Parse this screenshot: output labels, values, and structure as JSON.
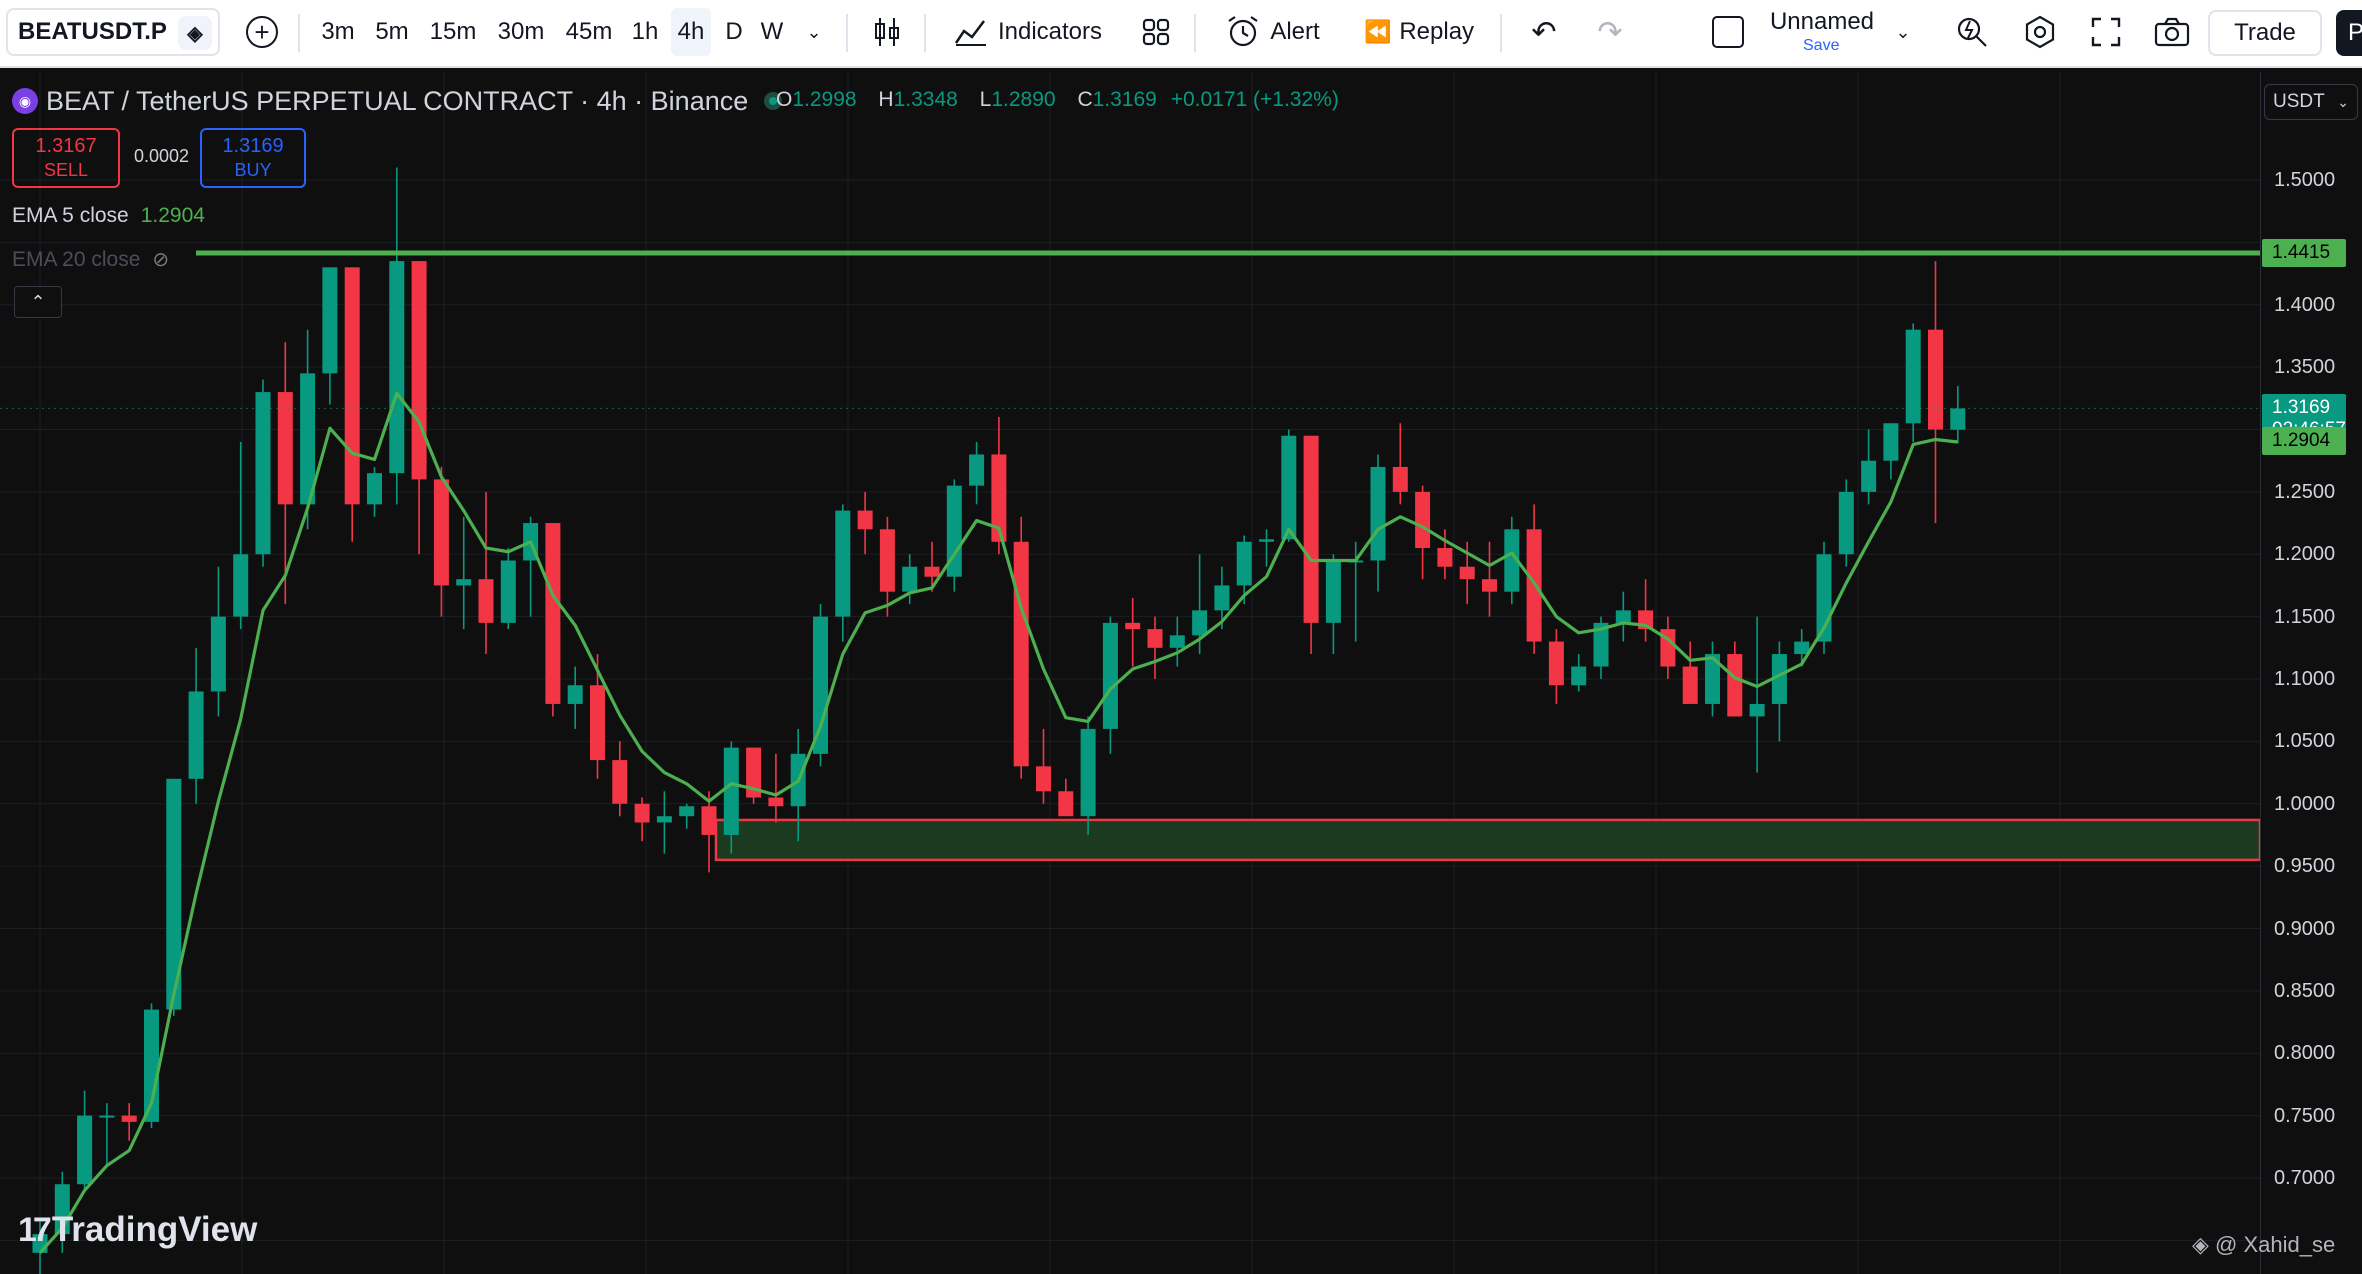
{
  "toolbar": {
    "symbol": "BEATUSDT.P",
    "timeframes": [
      "3m",
      "5m",
      "15m",
      "30m",
      "45m",
      "1h",
      "4h",
      "D",
      "W"
    ],
    "active_timeframe": "4h",
    "indicators_label": "Indicators",
    "alert_label": "Alert",
    "replay_label": "Replay",
    "layout_name": "Unnamed",
    "save_label": "Save",
    "trade_label": "Trade",
    "publish_initial": "P"
  },
  "legend": {
    "title": "BEAT / TetherUS PERPETUAL CONTRACT · 4h · Binance",
    "o_key": "O",
    "o": "1.2998",
    "h_key": "H",
    "h": "1.3348",
    "l_key": "L",
    "l": "1.2890",
    "c_key": "C",
    "c": "1.3169",
    "change": "+0.0171 (+1.32%)",
    "sell_price": "1.3167",
    "sell_label": "SELL",
    "spread": "0.0002",
    "buy_price": "1.3169",
    "buy_label": "BUY",
    "ema5_name": "EMA 5 close",
    "ema5_value": "1.2904",
    "ema20_name": "EMA 20 close"
  },
  "price_axis": {
    "currency": "USDT",
    "ticks": [
      "1.5000",
      "1.4000",
      "1.3500",
      "1.2500",
      "1.2000",
      "1.1500",
      "1.1000",
      "1.0500",
      "1.0000",
      "0.9500",
      "0.9000",
      "0.8500",
      "0.8000",
      "0.7500",
      "0.7000"
    ],
    "level_badge": "1.4415",
    "price_badge": "1.3169",
    "countdown": "02:46:57",
    "ema_badge": "1.2904"
  },
  "colors": {
    "up": "#089981",
    "down": "#f23645",
    "ema5": "#4caf50",
    "level_line": "#4caf50",
    "zone_fill": "#1b3a1f",
    "zone_border": "#f23645"
  },
  "chart_data": {
    "type": "candlestick",
    "symbol": "BEATUSDT.P",
    "interval": "4h",
    "ylim": [
      0.62,
      1.54
    ],
    "horizontal_level": 1.4415,
    "support_zone": [
      0.955,
      0.987
    ],
    "candles": [
      {
        "o": 0.64,
        "h": 0.665,
        "l": 0.62,
        "c": 0.655
      },
      {
        "o": 0.655,
        "h": 0.705,
        "l": 0.64,
        "c": 0.695
      },
      {
        "o": 0.695,
        "h": 0.77,
        "l": 0.69,
        "c": 0.75
      },
      {
        "o": 0.75,
        "h": 0.76,
        "l": 0.71,
        "c": 0.75
      },
      {
        "o": 0.75,
        "h": 0.76,
        "l": 0.73,
        "c": 0.745
      },
      {
        "o": 0.745,
        "h": 0.84,
        "l": 0.74,
        "c": 0.835
      },
      {
        "o": 0.835,
        "h": 0.98,
        "l": 0.83,
        "c": 1.02
      },
      {
        "o": 1.02,
        "h": 1.125,
        "l": 1.0,
        "c": 1.09
      },
      {
        "o": 1.09,
        "h": 1.19,
        "l": 1.07,
        "c": 1.15
      },
      {
        "o": 1.15,
        "h": 1.29,
        "l": 1.14,
        "c": 1.2
      },
      {
        "o": 1.2,
        "h": 1.34,
        "l": 1.19,
        "c": 1.33
      },
      {
        "o": 1.33,
        "h": 1.37,
        "l": 1.16,
        "c": 1.24
      },
      {
        "o": 1.24,
        "h": 1.38,
        "l": 1.22,
        "c": 1.345
      },
      {
        "o": 1.345,
        "h": 1.425,
        "l": 1.32,
        "c": 1.43
      },
      {
        "o": 1.43,
        "h": 1.41,
        "l": 1.21,
        "c": 1.24
      },
      {
        "o": 1.24,
        "h": 1.27,
        "l": 1.23,
        "c": 1.265
      },
      {
        "o": 1.265,
        "h": 1.51,
        "l": 1.24,
        "c": 1.435
      },
      {
        "o": 1.435,
        "h": 1.435,
        "l": 1.2,
        "c": 1.26
      },
      {
        "o": 1.26,
        "h": 1.27,
        "l": 1.15,
        "c": 1.175
      },
      {
        "o": 1.175,
        "h": 1.23,
        "l": 1.14,
        "c": 1.18
      },
      {
        "o": 1.18,
        "h": 1.25,
        "l": 1.12,
        "c": 1.145
      },
      {
        "o": 1.145,
        "h": 1.205,
        "l": 1.14,
        "c": 1.195
      },
      {
        "o": 1.195,
        "h": 1.23,
        "l": 1.15,
        "c": 1.225
      },
      {
        "o": 1.225,
        "h": 1.215,
        "l": 1.07,
        "c": 1.08
      },
      {
        "o": 1.08,
        "h": 1.11,
        "l": 1.06,
        "c": 1.095
      },
      {
        "o": 1.095,
        "h": 1.12,
        "l": 1.02,
        "c": 1.035
      },
      {
        "o": 1.035,
        "h": 1.05,
        "l": 0.99,
        "c": 1.0
      },
      {
        "o": 1.0,
        "h": 1.005,
        "l": 0.97,
        "c": 0.985
      },
      {
        "o": 0.985,
        "h": 1.01,
        "l": 0.96,
        "c": 0.99
      },
      {
        "o": 0.99,
        "h": 1.0,
        "l": 0.98,
        "c": 0.998
      },
      {
        "o": 0.998,
        "h": 1.01,
        "l": 0.945,
        "c": 0.975
      },
      {
        "o": 0.975,
        "h": 1.05,
        "l": 0.96,
        "c": 1.045
      },
      {
        "o": 1.045,
        "h": 1.045,
        "l": 1.0,
        "c": 1.005
      },
      {
        "o": 1.005,
        "h": 1.04,
        "l": 0.985,
        "c": 0.998
      },
      {
        "o": 0.998,
        "h": 1.06,
        "l": 0.97,
        "c": 1.04
      },
      {
        "o": 1.04,
        "h": 1.16,
        "l": 1.03,
        "c": 1.15
      },
      {
        "o": 1.15,
        "h": 1.24,
        "l": 1.13,
        "c": 1.235
      },
      {
        "o": 1.235,
        "h": 1.25,
        "l": 1.2,
        "c": 1.22
      },
      {
        "o": 1.22,
        "h": 1.23,
        "l": 1.15,
        "c": 1.17
      },
      {
        "o": 1.17,
        "h": 1.2,
        "l": 1.16,
        "c": 1.19
      },
      {
        "o": 1.19,
        "h": 1.21,
        "l": 1.17,
        "c": 1.182
      },
      {
        "o": 1.182,
        "h": 1.26,
        "l": 1.17,
        "c": 1.255
      },
      {
        "o": 1.255,
        "h": 1.29,
        "l": 1.24,
        "c": 1.28
      },
      {
        "o": 1.28,
        "h": 1.31,
        "l": 1.2,
        "c": 1.21
      },
      {
        "o": 1.21,
        "h": 1.23,
        "l": 1.02,
        "c": 1.03
      },
      {
        "o": 1.03,
        "h": 1.06,
        "l": 1.0,
        "c": 1.01
      },
      {
        "o": 1.01,
        "h": 1.02,
        "l": 0.99,
        "c": 0.99
      },
      {
        "o": 0.99,
        "h": 1.07,
        "l": 0.975,
        "c": 1.06
      },
      {
        "o": 1.06,
        "h": 1.15,
        "l": 1.04,
        "c": 1.145
      },
      {
        "o": 1.145,
        "h": 1.165,
        "l": 1.11,
        "c": 1.14
      },
      {
        "o": 1.14,
        "h": 1.15,
        "l": 1.1,
        "c": 1.125
      },
      {
        "o": 1.125,
        "h": 1.15,
        "l": 1.11,
        "c": 1.135
      },
      {
        "o": 1.135,
        "h": 1.2,
        "l": 1.12,
        "c": 1.155
      },
      {
        "o": 1.155,
        "h": 1.19,
        "l": 1.14,
        "c": 1.175
      },
      {
        "o": 1.175,
        "h": 1.215,
        "l": 1.16,
        "c": 1.21
      },
      {
        "o": 1.21,
        "h": 1.22,
        "l": 1.19,
        "c": 1.212
      },
      {
        "o": 1.212,
        "h": 1.3,
        "l": 1.21,
        "c": 1.295
      },
      {
        "o": 1.295,
        "h": 1.295,
        "l": 1.12,
        "c": 1.145
      },
      {
        "o": 1.145,
        "h": 1.2,
        "l": 1.12,
        "c": 1.195
      },
      {
        "o": 1.195,
        "h": 1.21,
        "l": 1.13,
        "c": 1.195
      },
      {
        "o": 1.195,
        "h": 1.28,
        "l": 1.17,
        "c": 1.27
      },
      {
        "o": 1.27,
        "h": 1.305,
        "l": 1.24,
        "c": 1.25
      },
      {
        "o": 1.25,
        "h": 1.255,
        "l": 1.18,
        "c": 1.205
      },
      {
        "o": 1.205,
        "h": 1.22,
        "l": 1.18,
        "c": 1.19
      },
      {
        "o": 1.19,
        "h": 1.21,
        "l": 1.16,
        "c": 1.18
      },
      {
        "o": 1.18,
        "h": 1.21,
        "l": 1.15,
        "c": 1.17
      },
      {
        "o": 1.17,
        "h": 1.23,
        "l": 1.16,
        "c": 1.22
      },
      {
        "o": 1.22,
        "h": 1.24,
        "l": 1.12,
        "c": 1.13
      },
      {
        "o": 1.13,
        "h": 1.14,
        "l": 1.08,
        "c": 1.095
      },
      {
        "o": 1.095,
        "h": 1.12,
        "l": 1.09,
        "c": 1.11
      },
      {
        "o": 1.11,
        "h": 1.15,
        "l": 1.1,
        "c": 1.145
      },
      {
        "o": 1.145,
        "h": 1.17,
        "l": 1.13,
        "c": 1.155
      },
      {
        "o": 1.155,
        "h": 1.18,
        "l": 1.13,
        "c": 1.14
      },
      {
        "o": 1.14,
        "h": 1.15,
        "l": 1.1,
        "c": 1.11
      },
      {
        "o": 1.11,
        "h": 1.13,
        "l": 1.08,
        "c": 1.08
      },
      {
        "o": 1.08,
        "h": 1.13,
        "l": 1.07,
        "c": 1.12
      },
      {
        "o": 1.12,
        "h": 1.13,
        "l": 1.07,
        "c": 1.07
      },
      {
        "o": 1.07,
        "h": 1.15,
        "l": 1.025,
        "c": 1.08
      },
      {
        "o": 1.08,
        "h": 1.13,
        "l": 1.05,
        "c": 1.12
      },
      {
        "o": 1.12,
        "h": 1.14,
        "l": 1.11,
        "c": 1.13
      },
      {
        "o": 1.13,
        "h": 1.21,
        "l": 1.12,
        "c": 1.2
      },
      {
        "o": 1.2,
        "h": 1.26,
        "l": 1.19,
        "c": 1.25
      },
      {
        "o": 1.25,
        "h": 1.3,
        "l": 1.24,
        "c": 1.275
      },
      {
        "o": 1.275,
        "h": 1.3,
        "l": 1.26,
        "c": 1.305
      },
      {
        "o": 1.305,
        "h": 1.385,
        "l": 1.29,
        "c": 1.38
      },
      {
        "o": 1.38,
        "h": 1.435,
        "l": 1.225,
        "c": 1.3
      },
      {
        "o": 1.2998,
        "h": 1.3348,
        "l": 1.289,
        "c": 1.3169
      }
    ],
    "ema5": [
      0.64,
      0.66,
      0.69,
      0.71,
      0.722,
      0.76,
      0.847,
      0.928,
      1.002,
      1.068,
      1.155,
      1.183,
      1.237,
      1.301,
      1.281,
      1.276,
      1.329,
      1.306,
      1.262,
      1.235,
      1.205,
      1.202,
      1.21,
      1.167,
      1.143,
      1.107,
      1.071,
      1.042,
      1.025,
      1.016,
      1.002,
      1.016,
      1.012,
      1.007,
      1.018,
      1.062,
      1.12,
      1.153,
      1.159,
      1.169,
      1.173,
      1.2,
      1.227,
      1.221,
      1.157,
      1.108,
      1.069,
      1.066,
      1.092,
      1.108,
      1.114,
      1.121,
      1.132,
      1.146,
      1.167,
      1.182,
      1.22,
      1.195,
      1.195,
      1.195,
      1.22,
      1.23,
      1.222,
      1.211,
      1.201,
      1.191,
      1.201,
      1.177,
      1.15,
      1.137,
      1.14,
      1.145,
      1.143,
      1.132,
      1.115,
      1.117,
      1.101,
      1.094,
      1.103,
      1.112,
      1.141,
      1.177,
      1.21,
      1.242,
      1.288,
      1.292,
      1.29
    ],
    "price_label_bid": "1.3167",
    "price_label_ask": "1.3169"
  },
  "watermark": {
    "brand": "TradingView",
    "author": "@ Xahid_se"
  }
}
